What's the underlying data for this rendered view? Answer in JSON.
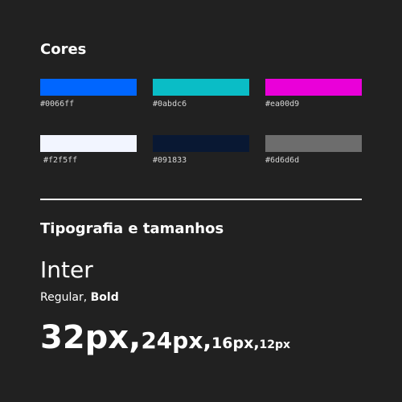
{
  "colors": {
    "title": "Cores",
    "swatches": [
      {
        "hex": "#0066ff",
        "label": "#0066ff"
      },
      {
        "hex": "#0abdc6",
        "label": "#0abdc6"
      },
      {
        "hex": "#ea00d9",
        "label": "#ea00d9"
      },
      {
        "hex": "#f2f5ff",
        "label": "#f2f5ff"
      },
      {
        "hex": "#091833",
        "label": "#091833"
      },
      {
        "hex": "#6d6d6d",
        "label": "#6d6d6d"
      }
    ]
  },
  "typography": {
    "title": "Tipografia e tamanhos",
    "font_name": "Inter",
    "weights": {
      "regular": "Regular",
      "separator": ", ",
      "bold": "Bold"
    },
    "sizes": [
      {
        "label": "32px",
        "sep": ","
      },
      {
        "label": "24px",
        "sep": ","
      },
      {
        "label": "16px",
        "sep": ","
      },
      {
        "label": "12px",
        "sep": ""
      }
    ]
  },
  "theme": {
    "background": "#212121",
    "text": "#ffffff"
  }
}
